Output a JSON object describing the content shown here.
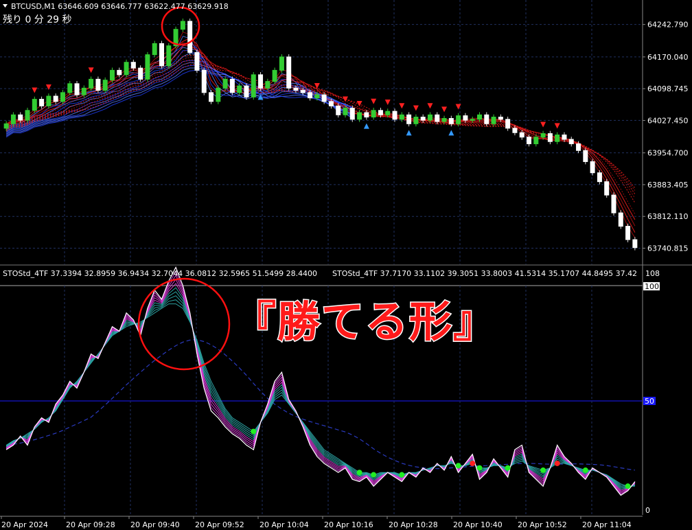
{
  "chart_data": [
    {
      "type": "candlestick",
      "symbol_header": "BTCUSD,M1  63646.609 63646.777 63622.477 63629.918",
      "timer_text": "残り 0 分 29 秒",
      "price_labels": [
        "64242.790",
        "64170.040",
        "64098.745",
        "64027.450",
        "63954.700",
        "63883.405",
        "63812.110",
        "63740.815"
      ],
      "ylim": [
        63720,
        64270
      ],
      "close_series": [
        64020,
        64040,
        64028,
        64050,
        64075,
        64060,
        64082,
        64070,
        64090,
        64110,
        64085,
        64100,
        64120,
        64095,
        64118,
        64140,
        64130,
        64158,
        64145,
        64120,
        64175,
        64200,
        64150,
        64195,
        64232,
        64250,
        64180,
        64140,
        64090,
        64070,
        64100,
        64120,
        64090,
        64105,
        64080,
        64130,
        64100,
        64115,
        64140,
        64170,
        64100,
        64095,
        64090,
        64078,
        64085,
        64070,
        64060,
        64040,
        64055,
        64030,
        64045,
        64035,
        64050,
        64040,
        64048,
        64030,
        64040,
        64020,
        64035,
        64028,
        64040,
        64025,
        64032,
        64020,
        64038,
        64028,
        64030,
        64040,
        64020,
        64035,
        64030,
        64010,
        64000,
        63990,
        63975,
        63990,
        63998,
        63980,
        63995,
        63985,
        63975,
        63960,
        63935,
        63910,
        63890,
        63860,
        63820,
        63790,
        63760,
        63742
      ]
    },
    {
      "type": "line",
      "indicator_header": "STOStd_4TF 37.3394 32.8959 36.9434 32.7044 36.0812 32.5965 51.5499 28.4400",
      "indicator_header_2": "STOStd_4TF 37.7170 33.1102 39.3051 33.8003 41.5314 35.1707 44.8495 37.42",
      "axis_labels": [
        "108",
        "100",
        "50",
        "0"
      ],
      "ylim": [
        0,
        108
      ],
      "series": [
        {
          "values": [
            28,
            30,
            34,
            30,
            38,
            42,
            40,
            48,
            52,
            58,
            55,
            62,
            70,
            68,
            75,
            82,
            80,
            88,
            85,
            78,
            90,
            98,
            94,
            102,
            108,
            100,
            88,
            70,
            55,
            45,
            42,
            38,
            35,
            33,
            30,
            28,
            40,
            48,
            58,
            62,
            50,
            45,
            38,
            30,
            25,
            22,
            20,
            18,
            20,
            15,
            14,
            16,
            12,
            15,
            18,
            16,
            14,
            18,
            16,
            20,
            18,
            22,
            19,
            25,
            18,
            22,
            26,
            15,
            18,
            24,
            20,
            16,
            28,
            30,
            18,
            15,
            12,
            20,
            30,
            25,
            22,
            18,
            15,
            20,
            18,
            16,
            12,
            8,
            10,
            14
          ]
        },
        {
          "values": [
            30,
            32,
            33,
            35,
            37,
            40,
            42,
            45,
            50,
            55,
            58,
            62,
            66,
            70,
            74,
            78,
            80,
            82,
            83,
            84,
            86,
            88,
            90,
            92,
            92,
            90,
            84,
            76,
            66,
            58,
            52,
            46,
            42,
            40,
            38,
            36,
            40,
            44,
            50,
            52,
            48,
            44,
            40,
            36,
            32,
            28,
            26,
            24,
            22,
            20,
            18,
            18,
            17,
            18,
            18,
            18,
            17,
            18,
            18,
            19,
            20,
            21,
            21,
            22,
            21,
            21,
            22,
            20,
            20,
            21,
            21,
            20,
            22,
            23,
            21,
            20,
            19,
            20,
            22,
            22,
            21,
            20,
            19,
            19,
            18,
            17,
            15,
            13,
            12,
            12
          ]
        }
      ],
      "axis_dates": [
        "20 Apr 2024",
        "20 Apr 09:28",
        "20 Apr 09:40",
        "20 Apr 09:52",
        "20 Apr 10:04",
        "20 Apr 10:16",
        "20 Apr 10:28",
        "20 Apr 10:40",
        "20 Apr 10:52",
        "20 Apr 11:04"
      ]
    }
  ],
  "annotation": "『勝てる形』",
  "colors": {
    "up": "#33cc33",
    "down": "#ffffff",
    "ma_blue": "#2040ff",
    "ma_red": "#ff2020",
    "sto_main": "#ffffff",
    "sto_magenta": "#e040e0",
    "sto_teal": "#30b0b0",
    "grid": "#203060",
    "level50": "#1a1aff",
    "signal_red": "#ff2020",
    "signal_green": "#22ee22",
    "circle": "#ff1010"
  }
}
